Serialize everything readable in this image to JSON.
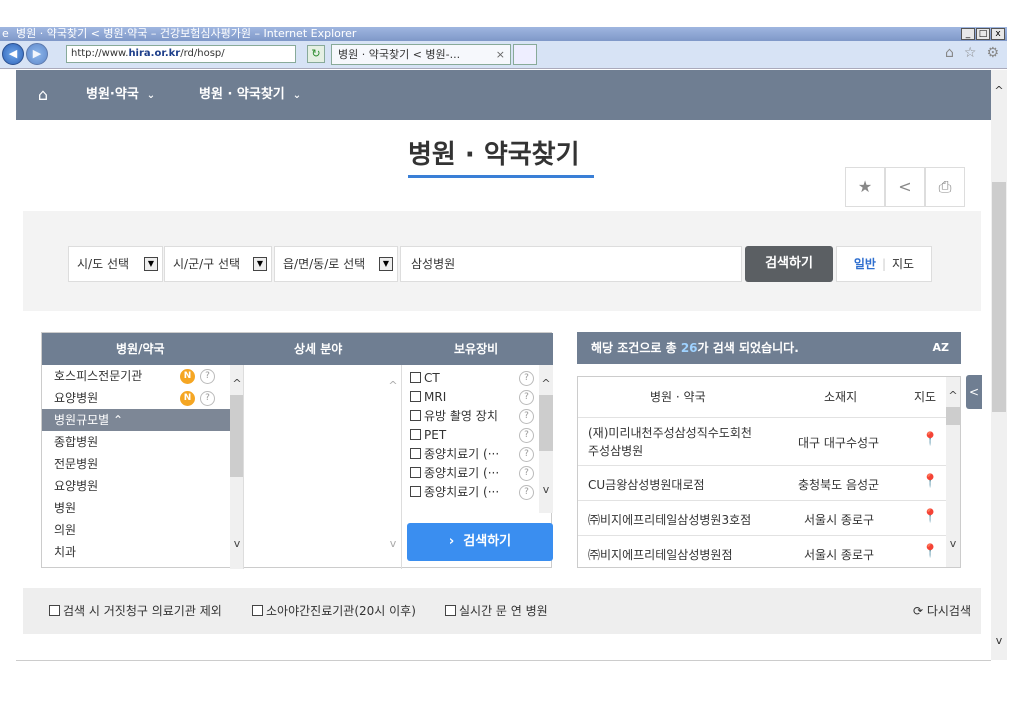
{
  "browser": {
    "window_title": "병원 · 약국찾기 < 병원·약국 – 건강보험심사평가원 – Internet Explorer",
    "address_prefix": "http://www.",
    "address_domain": "hira.or.kr",
    "address_rest": "/rd/hosp/",
    "tab_title": "병원 · 약국찾기 < 병원-...",
    "min": "_",
    "max": "□",
    "close": "x"
  },
  "topnav": {
    "home": "⌂",
    "item1": "병원·약국",
    "item2": "병원 · 약국찾기"
  },
  "page_title": "병원 · 약국찾기",
  "search": {
    "sido": "시/도 선택",
    "sigungu": "시/군/구 선택",
    "eupmyeon": "읍/면/동/로 선택",
    "keyword": "삼성병원",
    "search_button": "검색하기",
    "mode_general": "일반",
    "mode_map": "지도"
  },
  "filter": {
    "col1_header": "병원/약국",
    "col2_header": "상세 분야",
    "col3_header": "보유장비",
    "col1_items": [
      "호스피스전문기관",
      "요양병원",
      "병원규모별",
      "종합병원",
      "전문병원",
      "요양병원",
      "병원",
      "의원",
      "치과"
    ],
    "equipment": [
      "CT",
      "MRI",
      "유방 촬영 장치",
      "PET",
      "종양치료기 (···",
      "종양치료기 (···",
      "종양치료기 (···"
    ],
    "search_button": "검색하기"
  },
  "results": {
    "summary_prefix": "해당 조건으로 총 ",
    "count": "26",
    "summary_suffix": "가 검색 되었습니다.",
    "sort_label": "AZ",
    "col_name": "병원 · 약국",
    "col_location": "소재지",
    "col_map": "지도",
    "rows": [
      {
        "name_line1": "(재)미리내천주성삼성직수도회천",
        "name_line2": "주성삼병원",
        "location": "대구 대구수성구"
      },
      {
        "name_line1": "CU금왕삼성병원대로점",
        "location": "충청북도 음성군"
      },
      {
        "name_line1": "㈜비지에프리테일삼성병원3호점",
        "location": "서울시 종로구"
      },
      {
        "name_line1": "㈜비지에프리테일삼성병원점",
        "location": "서울시 종로구"
      }
    ]
  },
  "bottom": {
    "opt1": "검색 시 거짓청구 의료기관 제외",
    "opt2": "소아야간진료기관(20시 이후)",
    "opt3": "실시간 문 연 병원",
    "reset": "다시검색"
  }
}
